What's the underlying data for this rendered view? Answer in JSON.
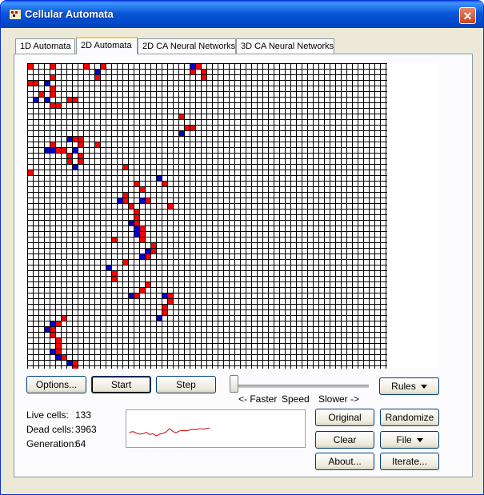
{
  "window": {
    "title": "Cellular Automata",
    "close_glyph": "✕"
  },
  "tabs": [
    {
      "label": "1D Automata",
      "active": false
    },
    {
      "label": "2D Automata",
      "active": true
    },
    {
      "label": "2D CA Neural Networks",
      "active": false
    },
    {
      "label": "3D CA Neural Networks",
      "active": false
    }
  ],
  "colors": {
    "cell_red": "#ff0000",
    "cell_blue": "#0000cc",
    "grid_line": "#000000",
    "graph_line": "#cc0000"
  },
  "grid": {
    "cols": 64,
    "rows": 55,
    "red": [
      [
        0,
        0
      ],
      [
        0,
        4
      ],
      [
        0,
        13
      ],
      [
        0,
        10
      ],
      [
        0,
        30
      ],
      [
        1,
        29
      ],
      [
        1,
        31
      ],
      [
        2,
        12
      ],
      [
        2,
        4
      ],
      [
        2,
        31
      ],
      [
        3,
        1
      ],
      [
        3,
        0
      ],
      [
        4,
        4
      ],
      [
        5,
        4
      ],
      [
        5,
        2
      ],
      [
        6,
        7
      ],
      [
        6,
        8
      ],
      [
        7,
        5
      ],
      [
        7,
        4
      ],
      [
        9,
        27
      ],
      [
        11,
        28
      ],
      [
        11,
        29
      ],
      [
        13,
        8
      ],
      [
        13,
        9
      ],
      [
        14,
        9
      ],
      [
        14,
        12
      ],
      [
        14,
        4
      ],
      [
        15,
        6
      ],
      [
        15,
        5
      ],
      [
        16,
        7
      ],
      [
        16,
        9
      ],
      [
        17,
        7
      ],
      [
        17,
        9
      ],
      [
        18,
        17
      ],
      [
        19,
        0
      ],
      [
        21,
        19
      ],
      [
        21,
        24
      ],
      [
        22,
        20
      ],
      [
        23,
        17
      ],
      [
        24,
        17
      ],
      [
        24,
        21
      ],
      [
        25,
        25
      ],
      [
        25,
        18
      ],
      [
        26,
        19
      ],
      [
        27,
        19
      ],
      [
        28,
        19
      ],
      [
        29,
        20
      ],
      [
        30,
        20
      ],
      [
        31,
        20
      ],
      [
        31,
        15
      ],
      [
        32,
        22
      ],
      [
        33,
        22
      ],
      [
        34,
        21
      ],
      [
        35,
        17
      ],
      [
        37,
        15
      ],
      [
        38,
        15
      ],
      [
        39,
        21
      ],
      [
        40,
        20
      ],
      [
        41,
        19
      ],
      [
        41,
        25
      ],
      [
        42,
        25
      ],
      [
        43,
        24
      ],
      [
        44,
        24
      ],
      [
        45,
        6
      ],
      [
        46,
        5
      ],
      [
        47,
        4
      ],
      [
        48,
        4
      ],
      [
        49,
        5
      ],
      [
        50,
        5
      ],
      [
        51,
        5
      ],
      [
        52,
        6
      ],
      [
        53,
        8
      ],
      [
        54,
        8
      ]
    ]
  },
  "stats": {
    "live_label": "Live cells:",
    "live_value": "133",
    "dead_label": "Dead cells:",
    "dead_value": "3963",
    "gen_label": "Generation:",
    "gen_value": "64"
  },
  "buttons": {
    "options": "Options...",
    "start": "Start",
    "step": "Step",
    "rules": "Rules",
    "original": "Original",
    "randomize": "Randomize",
    "clear": "Clear",
    "file": "File",
    "about": "About...",
    "iterate": "Iterate..."
  },
  "speed": {
    "faster": "<- Faster",
    "label": "Speed",
    "slower": "Slower ->",
    "value": 0
  },
  "graph": {
    "values": [
      0.4,
      0.42,
      0.38,
      0.35,
      0.36,
      0.4,
      0.34,
      0.36,
      0.3,
      0.35,
      0.37,
      0.41,
      0.5,
      0.42,
      0.39,
      0.44,
      0.45,
      0.44,
      0.46,
      0.48,
      0.47,
      0.5,
      0.49,
      0.5,
      0.52
    ]
  }
}
